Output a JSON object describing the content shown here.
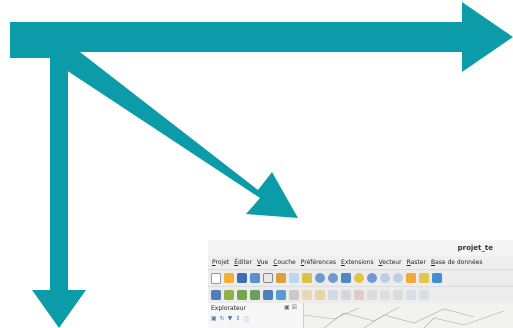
{
  "colors": {
    "arrow": "#0c9ba9",
    "window_bg": "#ffffff",
    "menubar_bg": "#efefef",
    "toolbar_bg": "#ececec"
  },
  "arrows": [
    {
      "name": "arrow-right",
      "direction": "right"
    },
    {
      "name": "arrow-down-right",
      "direction": "down-right"
    },
    {
      "name": "arrow-down",
      "direction": "down"
    }
  ],
  "qgis": {
    "title": "projet_te",
    "menu": [
      "Projet",
      "Éditer",
      "Vue",
      "Couche",
      "Préférences",
      "Extensions",
      "Vecteur",
      "Raster",
      "Base de données"
    ],
    "toolbar1_icons": [
      "new-project-icon",
      "open-folder-icon",
      "save-icon",
      "save-as-icon",
      "print-layout-icon",
      "layout-manager-icon",
      "pan-hand-icon",
      "pan-to-selection-icon",
      "zoom-in-icon",
      "zoom-out-icon",
      "zoom-full-icon",
      "zoom-selection-icon",
      "zoom-layer-icon",
      "zoom-native-icon",
      "zoom-last-icon",
      "new-map-view-icon",
      "temporal-icon",
      "identify-icon"
    ],
    "toolbar2_icons": [
      "data-source-manager-icon",
      "new-geopackage-icon",
      "add-vector-icon",
      "add-delimited-text-icon",
      "add-raster-icon",
      "add-wms-icon",
      "digitize-icon",
      "edit-pencil-icon",
      "save-edits-icon",
      "add-feature-icon",
      "move-feature-icon",
      "delete-selected-icon",
      "cut-features-icon",
      "copy-features-icon",
      "paste-features-icon",
      "undo-icon",
      "redo-icon"
    ],
    "panel": {
      "title": "Explorateur",
      "controls": "▣ ☒",
      "tools": [
        "add-icon",
        "refresh-icon",
        "filter-icon",
        "collapse-icon",
        "info-icon"
      ],
      "tool_glyphs": [
        "▣",
        "↻",
        "▼",
        "⇕",
        "ⓘ"
      ]
    }
  }
}
